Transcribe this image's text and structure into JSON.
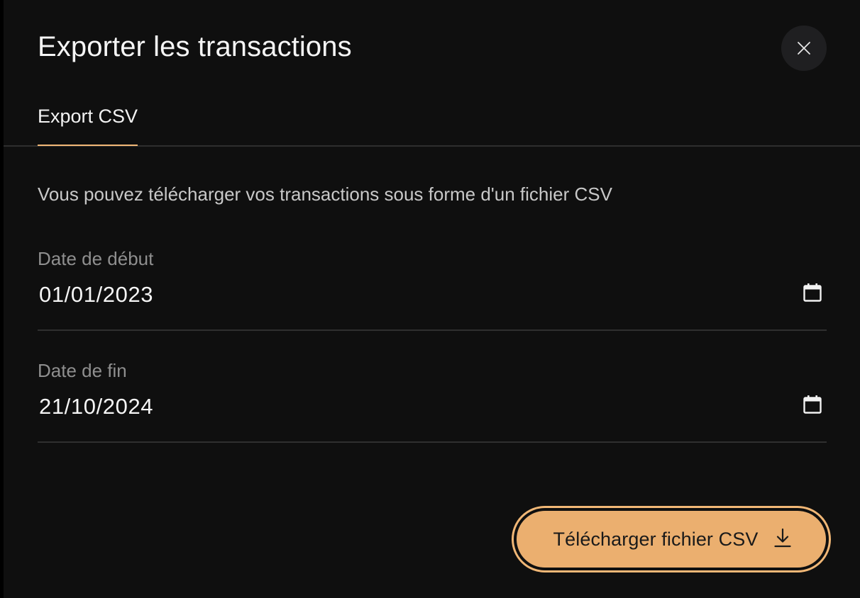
{
  "dialog": {
    "title": "Exporter les transactions",
    "close_icon": "close-icon"
  },
  "tabs": [
    {
      "label": "Export CSV",
      "active": true
    }
  ],
  "description": "Vous pouvez télécharger vos transactions sous forme d'un fichier CSV",
  "fields": {
    "start_date": {
      "label": "Date de début",
      "value": "01/01/2023",
      "icon": "calendar-icon"
    },
    "end_date": {
      "label": "Date de fin",
      "value": "21/10/2024",
      "icon": "calendar-icon"
    }
  },
  "download_button": {
    "label": "Télécharger fichier CSV",
    "icon": "download-icon"
  },
  "colors": {
    "background": "#0f0f0f",
    "accent": "#ebaf6f",
    "accent_border": "#f1b776",
    "text_primary": "#f5f5f5",
    "text_muted": "#8f8f8f",
    "divider": "#2e2e2e"
  }
}
